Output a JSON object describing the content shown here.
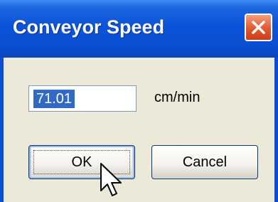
{
  "dialog": {
    "title": "Conveyor Speed",
    "close_icon": "close-icon"
  },
  "speed": {
    "value": "71.01",
    "unit": "cm/min"
  },
  "buttons": {
    "ok_label": "OK",
    "cancel_label": "Cancel"
  },
  "colors": {
    "titlebar": "#0a53d8",
    "close_button": "#e2582f",
    "selection": "#316ac5",
    "window_face": "#ece9d8"
  },
  "cursor": {
    "icon": "pointer-cursor-icon"
  }
}
